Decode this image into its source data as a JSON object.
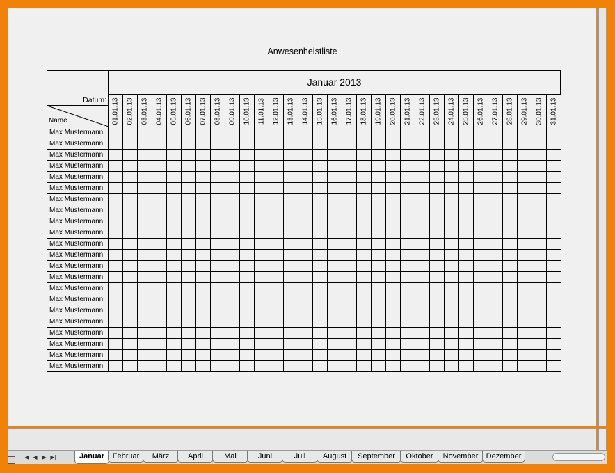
{
  "sheet": {
    "title": "Anwesenheistliste",
    "month_heading": "Januar 2013",
    "datum_label": "Datum:",
    "name_label": "Name",
    "dates": [
      "01.01.13",
      "02.01.13",
      "03.01.13",
      "04.01.13",
      "05.01.13",
      "06.01.13",
      "07.01.13",
      "08.01.13",
      "09.01.13",
      "10.01.13",
      "11.01.13",
      "12.01.13",
      "13.01.13",
      "14.01.13",
      "15.01.13",
      "16.01.13",
      "17.01.13",
      "18.01.13",
      "19.01.13",
      "20.01.13",
      "21.01.13",
      "22.01.13",
      "23.01.13",
      "24.01.13",
      "25.01.13",
      "26.01.13",
      "27.01.13",
      "28.01.13",
      "29.01.13",
      "30.01.13",
      "31.01.13"
    ],
    "rows": [
      "Max Mustermann",
      "Max Mustermann",
      "Max Mustermann",
      "Max Mustermann",
      "Max Mustermann",
      "Max Mustermann",
      "Max Mustermann",
      "Max Mustermann",
      "Max Mustermann",
      "Max Mustermann",
      "Max Mustermann",
      "Max Mustermann",
      "Max Mustermann",
      "Max Mustermann",
      "Max Mustermann",
      "Max Mustermann",
      "Max Mustermann",
      "Max Mustermann",
      "Max Mustermann",
      "Max Mustermann",
      "Max Mustermann",
      "Max Mustermann"
    ]
  },
  "tabs": {
    "active": "Januar",
    "items": [
      "Januar",
      "Februar",
      "März",
      "April",
      "Mai",
      "Juni",
      "Juli",
      "August",
      "September",
      "Oktober",
      "November",
      "Dezember"
    ]
  },
  "tab_nav": {
    "icons": [
      "first-sheet-icon",
      "prev-sheet-icon",
      "next-sheet-icon",
      "last-sheet-icon"
    ],
    "glyphs": [
      "|◀",
      "◀",
      "▶",
      "▶|"
    ]
  },
  "colors": {
    "window_border": "#f0820a",
    "sheet_background": "#f0f0f0",
    "grid_lines": "#000000"
  }
}
